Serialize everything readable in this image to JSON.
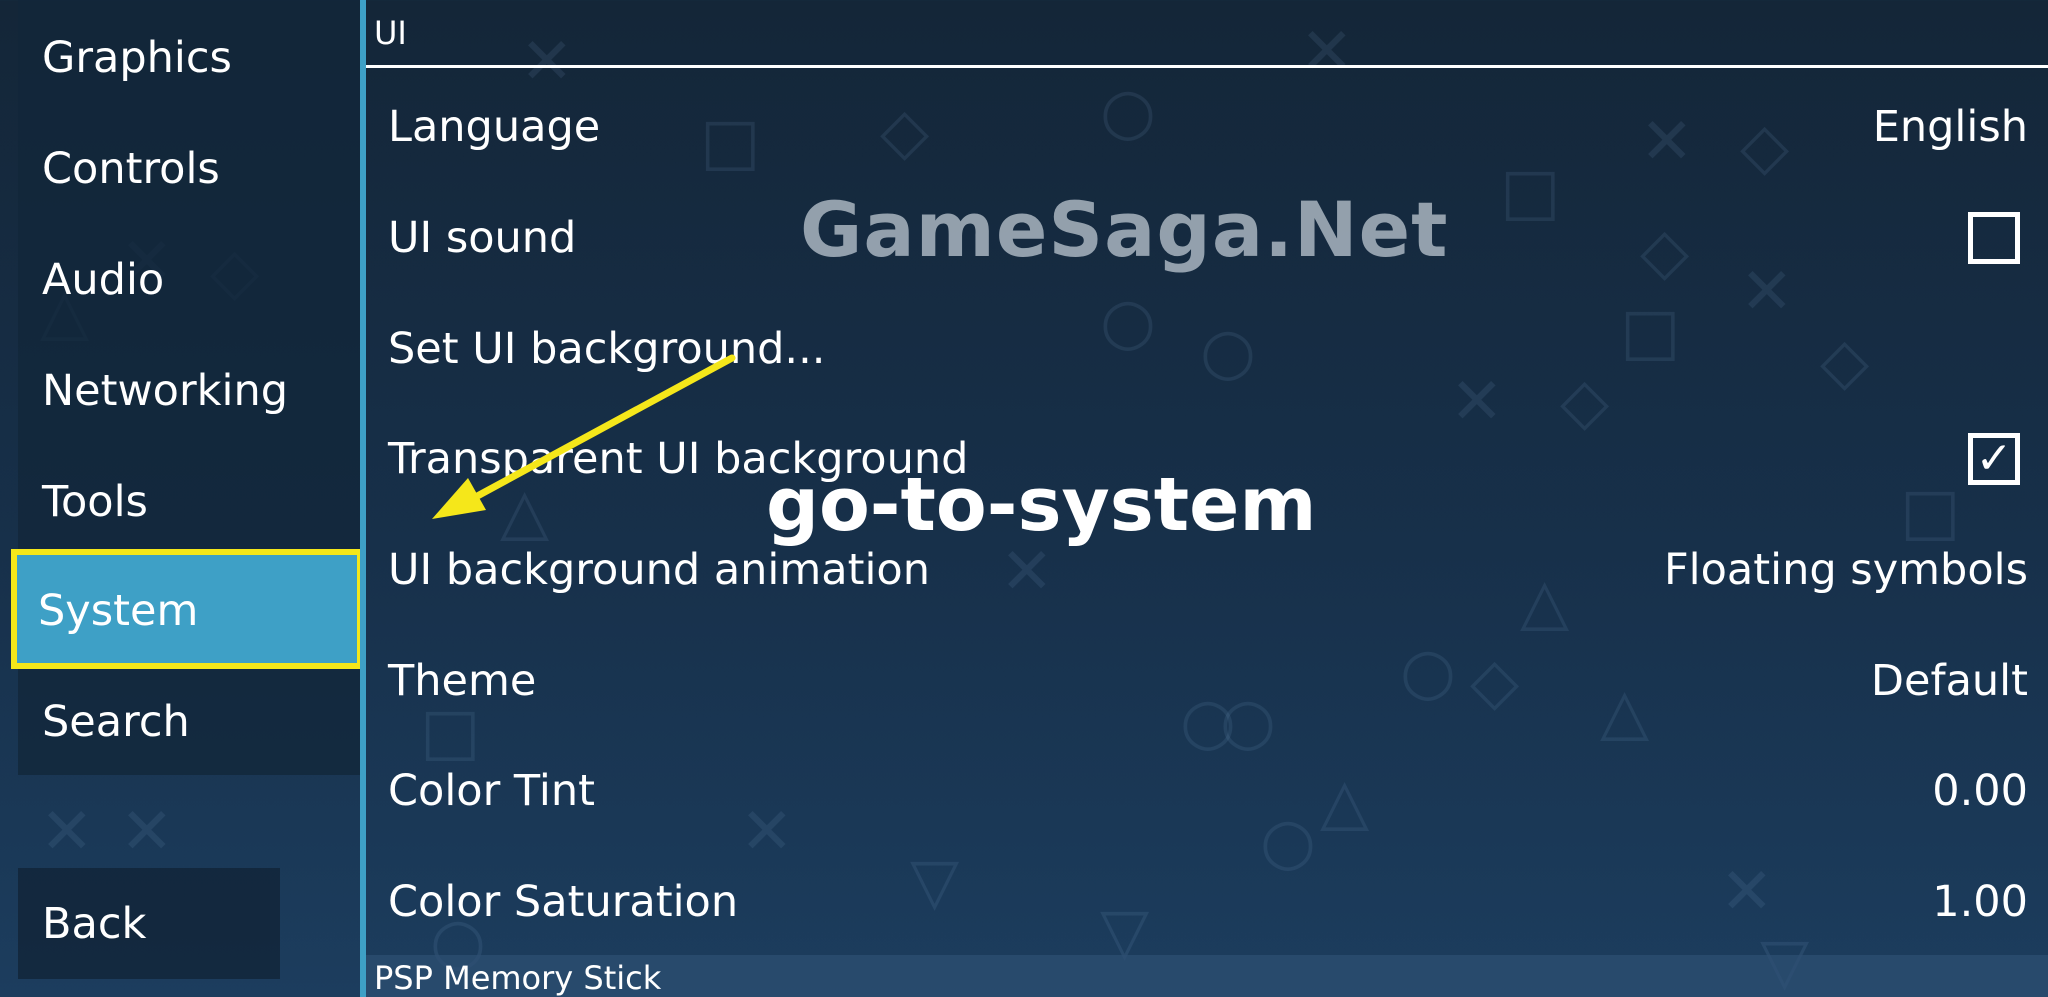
{
  "sidebar": {
    "items": [
      {
        "label": "Graphics",
        "active": false
      },
      {
        "label": "Controls",
        "active": false
      },
      {
        "label": "Audio",
        "active": false
      },
      {
        "label": "Networking",
        "active": false
      },
      {
        "label": "Tools",
        "active": false
      },
      {
        "label": "System",
        "active": true
      },
      {
        "label": "Search",
        "active": false
      }
    ],
    "back_label": "Back"
  },
  "main": {
    "section_title": "UI",
    "rows": [
      {
        "label": "Language",
        "type": "value",
        "value": "English"
      },
      {
        "label": "UI sound",
        "type": "checkbox",
        "checked": false
      },
      {
        "label": "Set UI background...",
        "type": "action"
      },
      {
        "label": "Transparent UI background",
        "type": "checkbox",
        "checked": true
      },
      {
        "label": "UI background animation",
        "type": "value",
        "value": "Floating symbols"
      },
      {
        "label": "Theme",
        "type": "value",
        "value": "Default"
      },
      {
        "label": "Color Tint",
        "type": "value",
        "value": "0.00"
      },
      {
        "label": "Color Saturation",
        "type": "value",
        "value": "1.00"
      }
    ],
    "next_section_title": "PSP Memory Stick"
  },
  "overlay": {
    "watermark": "GameSaga.Net",
    "annotation": "go-to-system",
    "highlight_color": "#f5e71a",
    "arrow_color": "#f5e71a"
  },
  "icons": {
    "check": "✓"
  },
  "colors": {
    "accent": "#3ea0c6",
    "background": "#17304a"
  }
}
